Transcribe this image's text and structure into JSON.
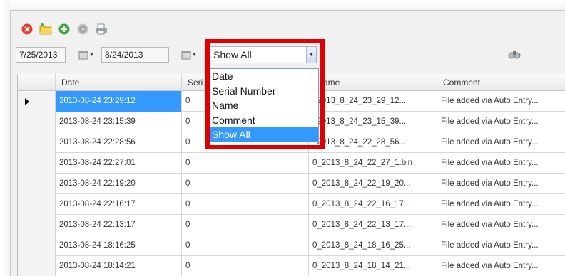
{
  "toolbar": {
    "buttons": [
      {
        "name": "delete-icon",
        "color": "#e04030"
      },
      {
        "name": "folder-icon",
        "color": "#e8c030"
      },
      {
        "name": "add-icon",
        "color": "#3aa53a"
      },
      {
        "name": "refresh-icon",
        "color": "#b5b5b5"
      },
      {
        "name": "print-icon",
        "color": "#8a8a8a"
      }
    ]
  },
  "filter": {
    "start_date": "7/25/2013",
    "end_date": "8/24/2013",
    "selected_field": "Show All",
    "search_icon": "binoculars-icon"
  },
  "dropdown": {
    "options": [
      "Date",
      "Serial Number",
      "Name",
      "Comment",
      "Show All"
    ],
    "selected_index": 4
  },
  "grid": {
    "columns": [
      "Date",
      "Seri",
      "ame",
      "Comment"
    ],
    "rows": [
      {
        "date": "2013-08-24 23:29:12",
        "serial": "0",
        "name": "_2013_8_24_23_29_12...",
        "comment": "File added via Auto Entry...",
        "selected": true
      },
      {
        "date": "2013-08-24 23:15:39",
        "serial": "0",
        "name": "_2013_8_24_23_15_39...",
        "comment": "File added via Auto Entry..."
      },
      {
        "date": "2013-08-24 22:28:56",
        "serial": "0",
        "name": "_2013_8_24_22_28_56...",
        "comment": "File added via Auto Entry..."
      },
      {
        "date": "2013-08-24 22:27:01",
        "serial": "0",
        "name": "0_2013_8_24_22_27_1.bin",
        "comment": "File added via Auto Entry..."
      },
      {
        "date": "2013-08-24 22:19:20",
        "serial": "0",
        "name": "0_2013_8_24_22_19_20...",
        "comment": "File added via Auto Entry..."
      },
      {
        "date": "2013-08-24 22:16:17",
        "serial": "0",
        "name": "0_2013_8_24_22_16_17...",
        "comment": "File added via Auto Entry..."
      },
      {
        "date": "2013-08-24 22:13:17",
        "serial": "0",
        "name": "0_2013_8_24_22_13_17...",
        "comment": "File added via Auto Entry..."
      },
      {
        "date": "2013-08-24 18:16:25",
        "serial": "0",
        "name": "0_2013_8_24_18_16_25...",
        "comment": "File added via Auto Entry..."
      },
      {
        "date": "2013-08-24 18:14:21",
        "serial": "0",
        "name": "0_2013_8_24_18_14_21...",
        "comment": "File added via Auto Entry..."
      }
    ]
  },
  "colors": {
    "highlight": "#e00000",
    "selection": "#3399ff"
  }
}
